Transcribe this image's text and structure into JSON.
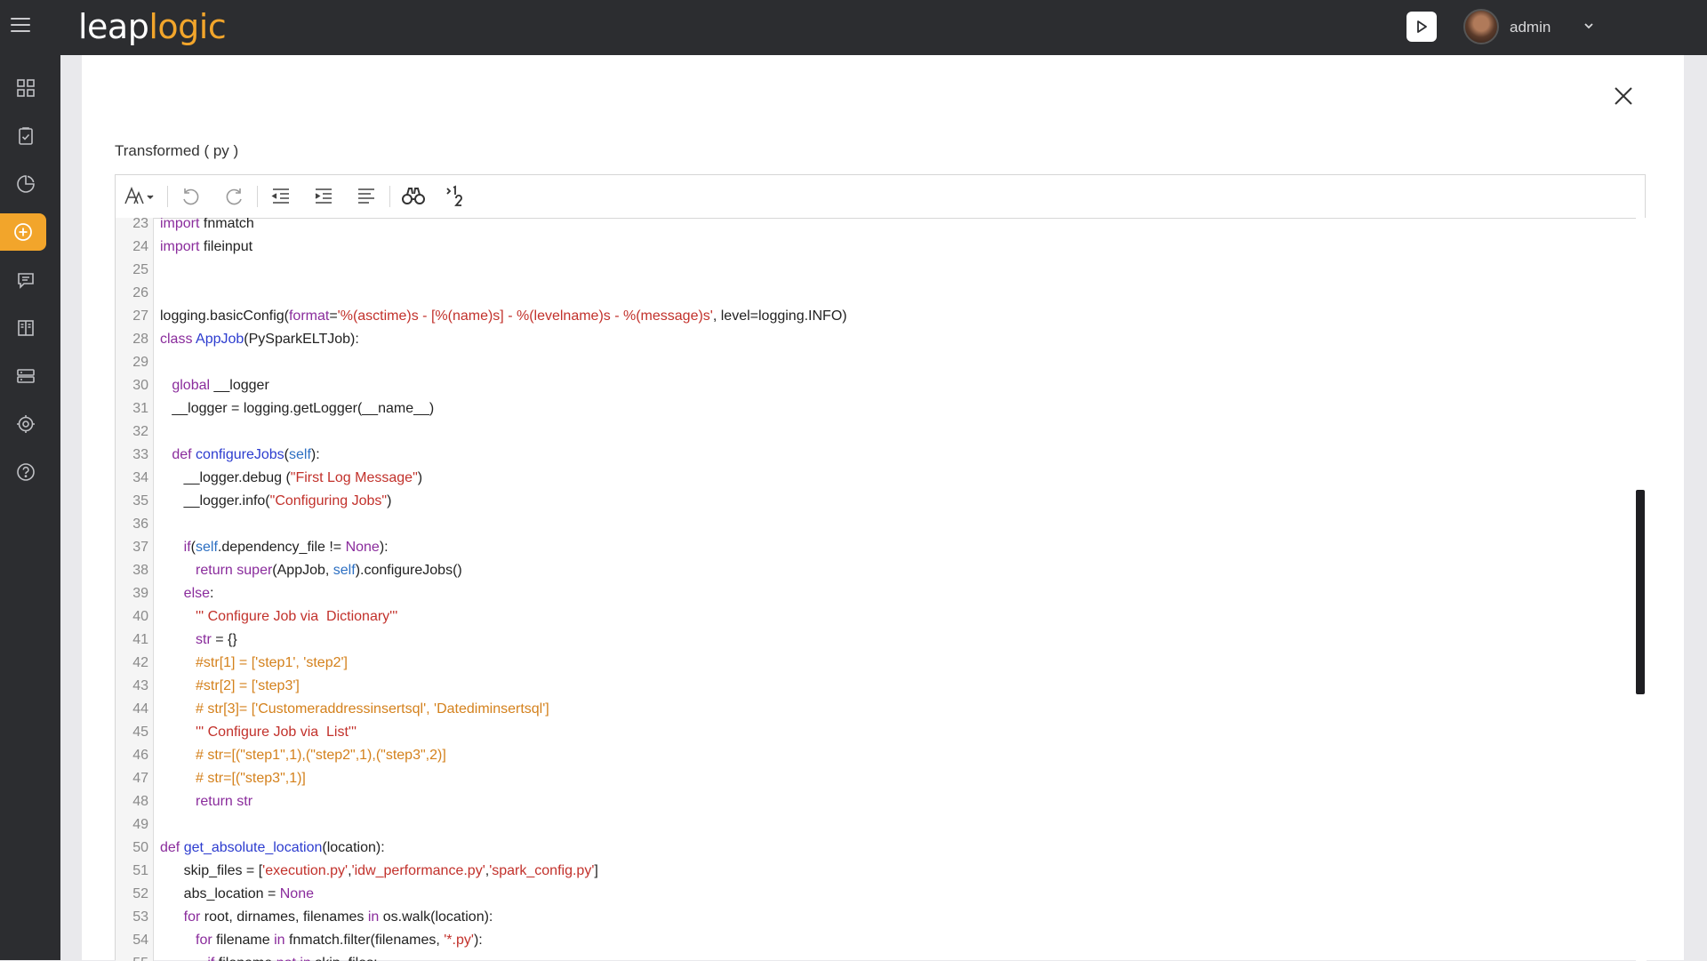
{
  "header": {
    "logo_part1": "leap",
    "logo_part2": "logic",
    "username": "admin",
    "icons": [
      "hamburger-icon",
      "play-icon",
      "chevron-down-icon"
    ]
  },
  "sidebar": {
    "items": [
      {
        "icon": "dashboard-icon",
        "active": false
      },
      {
        "icon": "clipboard-check-icon",
        "active": false
      },
      {
        "icon": "pie-chart-icon",
        "active": false
      },
      {
        "icon": "add-circle-icon",
        "active": true
      },
      {
        "icon": "chat-icon",
        "active": false
      },
      {
        "icon": "book-icon",
        "active": false
      },
      {
        "icon": "server-icon",
        "active": false
      },
      {
        "icon": "settings-network-icon",
        "active": false
      },
      {
        "icon": "help-icon",
        "active": false
      }
    ],
    "active_color": "#f2a52b"
  },
  "panel": {
    "title": "Transformed ( py )"
  },
  "toolbar": {
    "buttons": [
      "font-size-icon",
      "undo-icon",
      "redo-icon",
      "outdent-icon",
      "indent-icon",
      "format-icon",
      "find-icon",
      "goto-line-icon"
    ]
  },
  "code": {
    "lines": [
      {
        "n": "23",
        "tokens": [
          [
            "kw",
            "import"
          ],
          [
            "t",
            " fnmatch"
          ]
        ]
      },
      {
        "n": "24",
        "tokens": [
          [
            "kw",
            "import"
          ],
          [
            "t",
            " fileinput"
          ]
        ]
      },
      {
        "n": "25",
        "tokens": []
      },
      {
        "n": "26",
        "tokens": []
      },
      {
        "n": "27",
        "tokens": [
          [
            "t",
            "logging.basicConfig("
          ],
          [
            "kw",
            "format"
          ],
          [
            "t",
            "="
          ],
          [
            "str",
            "'%(asctime)s - [%(name)s] - %(levelname)s - %(message)s'"
          ],
          [
            "t",
            ", level=logging.INFO)"
          ]
        ]
      },
      {
        "n": "28",
        "tokens": [
          [
            "kw",
            "class"
          ],
          [
            "t",
            " "
          ],
          [
            "fn",
            "AppJob"
          ],
          [
            "t",
            "(PySparkELTJob):"
          ]
        ]
      },
      {
        "n": "29",
        "tokens": []
      },
      {
        "n": "30",
        "tokens": [
          [
            "t",
            "   "
          ],
          [
            "kw",
            "global"
          ],
          [
            "t",
            " __logger"
          ]
        ]
      },
      {
        "n": "31",
        "tokens": [
          [
            "t",
            "   __logger = logging.getLogger(__name__)"
          ]
        ]
      },
      {
        "n": "32",
        "tokens": []
      },
      {
        "n": "33",
        "tokens": [
          [
            "t",
            "   "
          ],
          [
            "kw",
            "def"
          ],
          [
            "t",
            " "
          ],
          [
            "fn",
            "configureJobs"
          ],
          [
            "t",
            "("
          ],
          [
            "bi",
            "self"
          ],
          [
            "t",
            "):"
          ]
        ]
      },
      {
        "n": "34",
        "tokens": [
          [
            "t",
            "      __logger.debug ("
          ],
          [
            "str",
            "\"First Log Message\""
          ],
          [
            "t",
            ")"
          ]
        ]
      },
      {
        "n": "35",
        "tokens": [
          [
            "t",
            "      __logger.info("
          ],
          [
            "str",
            "\"Configuring Jobs\""
          ],
          [
            "t",
            ")"
          ]
        ]
      },
      {
        "n": "36",
        "tokens": []
      },
      {
        "n": "37",
        "tokens": [
          [
            "t",
            "      "
          ],
          [
            "kw",
            "if"
          ],
          [
            "t",
            "("
          ],
          [
            "bi",
            "self"
          ],
          [
            "t",
            ".dependency_file != "
          ],
          [
            "kw",
            "None"
          ],
          [
            "t",
            "):"
          ]
        ]
      },
      {
        "n": "38",
        "tokens": [
          [
            "t",
            "         "
          ],
          [
            "kw",
            "return"
          ],
          [
            "t",
            " "
          ],
          [
            "kw",
            "super"
          ],
          [
            "t",
            "(AppJob, "
          ],
          [
            "bi",
            "self"
          ],
          [
            "t",
            ").configureJobs()"
          ]
        ]
      },
      {
        "n": "39",
        "tokens": [
          [
            "t",
            "      "
          ],
          [
            "kw",
            "else"
          ],
          [
            "t",
            ":"
          ]
        ]
      },
      {
        "n": "40",
        "tokens": [
          [
            "t",
            "         "
          ],
          [
            "str",
            "''' Configure Job via  Dictionary'''"
          ]
        ]
      },
      {
        "n": "41",
        "tokens": [
          [
            "t",
            "         "
          ],
          [
            "kw",
            "str"
          ],
          [
            "t",
            " = {}"
          ]
        ]
      },
      {
        "n": "42",
        "tokens": [
          [
            "t",
            "         "
          ],
          [
            "cm",
            "#str[1] = ['step1', 'step2']"
          ]
        ]
      },
      {
        "n": "43",
        "tokens": [
          [
            "t",
            "         "
          ],
          [
            "cm",
            "#str[2] = ['step3']"
          ]
        ]
      },
      {
        "n": "44",
        "tokens": [
          [
            "t",
            "         "
          ],
          [
            "cm",
            "# str[3]= ['Customeraddressinsertsql', 'Datediminsertsql']"
          ]
        ]
      },
      {
        "n": "45",
        "tokens": [
          [
            "t",
            "         "
          ],
          [
            "str",
            "''' Configure Job via  List'''"
          ]
        ]
      },
      {
        "n": "46",
        "tokens": [
          [
            "t",
            "         "
          ],
          [
            "cm",
            "# str=[(\"step1\",1),(\"step2\",1),(\"step3\",2)]"
          ]
        ]
      },
      {
        "n": "47",
        "tokens": [
          [
            "t",
            "         "
          ],
          [
            "cm",
            "# str=[(\"step3\",1)]"
          ]
        ]
      },
      {
        "n": "48",
        "tokens": [
          [
            "t",
            "         "
          ],
          [
            "kw",
            "return str"
          ]
        ]
      },
      {
        "n": "49",
        "tokens": []
      },
      {
        "n": "50",
        "tokens": [
          [
            "kw",
            "def"
          ],
          [
            "t",
            " "
          ],
          [
            "fn",
            "get_absolute_location"
          ],
          [
            "t",
            "(location):"
          ]
        ]
      },
      {
        "n": "51",
        "tokens": [
          [
            "t",
            "      skip_files = ["
          ],
          [
            "str",
            "'execution.py'"
          ],
          [
            "t",
            ","
          ],
          [
            "str",
            "'idw_performance.py'"
          ],
          [
            "t",
            ","
          ],
          [
            "str",
            "'spark_config.py'"
          ],
          [
            "t",
            "]"
          ]
        ]
      },
      {
        "n": "52",
        "tokens": [
          [
            "t",
            "      abs_location = "
          ],
          [
            "kw",
            "None"
          ]
        ]
      },
      {
        "n": "53",
        "tokens": [
          [
            "t",
            "      "
          ],
          [
            "kw",
            "for"
          ],
          [
            "t",
            " root, dirnames, filenames "
          ],
          [
            "kw",
            "in"
          ],
          [
            "t",
            " os.walk(location):"
          ]
        ]
      },
      {
        "n": "54",
        "tokens": [
          [
            "t",
            "         "
          ],
          [
            "kw",
            "for"
          ],
          [
            "t",
            " filename "
          ],
          [
            "kw",
            "in"
          ],
          [
            "t",
            " fnmatch.filter(filenames, "
          ],
          [
            "str",
            "'*.py'"
          ],
          [
            "t",
            "):"
          ]
        ]
      },
      {
        "n": "55",
        "tokens": [
          [
            "t",
            "            "
          ],
          [
            "kw",
            "if"
          ],
          [
            "t",
            " filename "
          ],
          [
            "kw",
            "not in"
          ],
          [
            "t",
            " skip_files:"
          ]
        ]
      }
    ]
  }
}
